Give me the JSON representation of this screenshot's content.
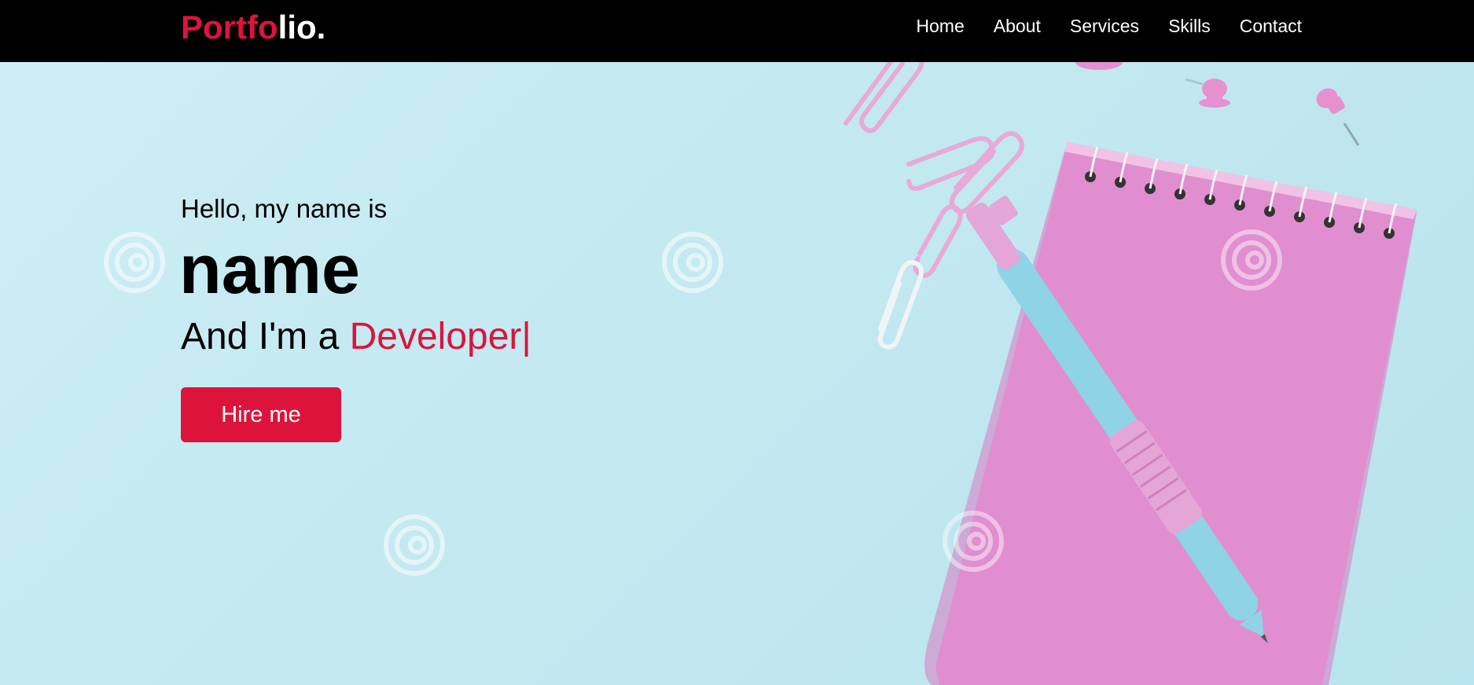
{
  "navbar": {
    "logo_accent": "Portfo",
    "logo_rest": "lio.",
    "menu": [
      "Home",
      "About",
      "Services",
      "Skills",
      "Contact"
    ]
  },
  "hero": {
    "greeting": "Hello, my name is",
    "name": "name",
    "role_prefix": "And I'm a ",
    "role": "Developer",
    "cursor": "|",
    "button_label": "Hire me"
  },
  "colors": {
    "accent": "#dc143c",
    "navbar_bg": "#000000",
    "hero_bg": "#c4e9f1",
    "notebook": "#e08ed0",
    "pen": "#8fd3e6"
  },
  "icons": [
    "spiral-watermark-icon",
    "paperclip-icon",
    "pushpin-icon",
    "notebook-icon",
    "pen-icon"
  ]
}
